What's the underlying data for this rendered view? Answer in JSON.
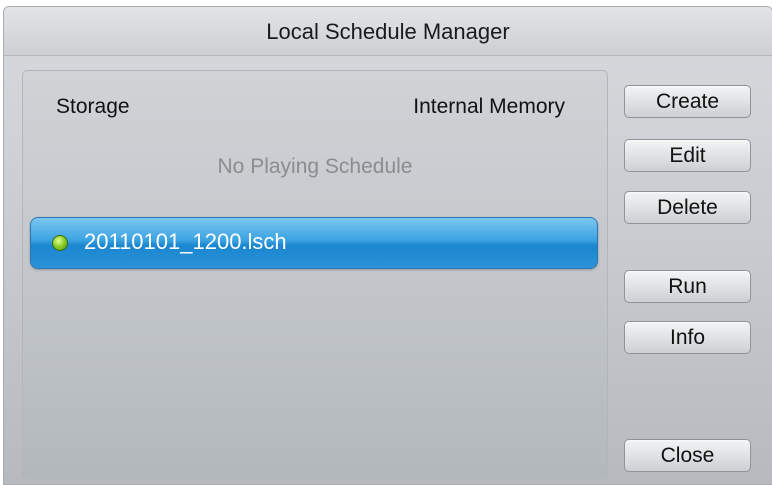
{
  "window": {
    "title": "Local Schedule Manager"
  },
  "storage": {
    "label": "Storage",
    "value": "Internal Memory"
  },
  "status_text": "No Playing Schedule",
  "schedules": [
    {
      "name": "20110101_1200.lsch",
      "selected": true,
      "status_color": "#8fd12a"
    }
  ],
  "buttons": {
    "create": "Create",
    "edit": "Edit",
    "delete": "Delete",
    "run": "Run",
    "info": "Info",
    "close": "Close"
  },
  "colors": {
    "selection": "#3aa2e2",
    "status_indicator": "#8fd12a"
  }
}
